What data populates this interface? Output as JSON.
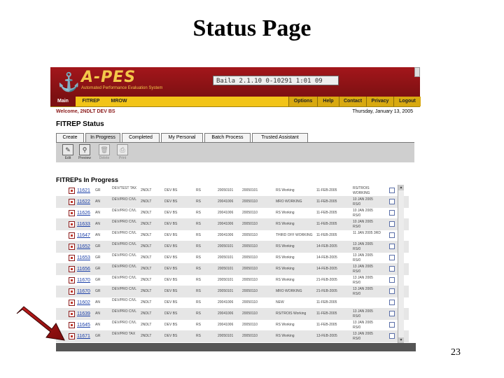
{
  "slide": {
    "title": "Status Page",
    "page_number": "23"
  },
  "app": {
    "logo_text": "A-PES",
    "logo_subtitle": "Automated Performance Evaluation System",
    "ticker": "Baila 2.1.10 0-10291 1:01 09"
  },
  "menu": {
    "left_tabs": [
      {
        "label": "Main"
      },
      {
        "label": "FITREP"
      },
      {
        "label": "MROW"
      }
    ],
    "right_tabs": [
      {
        "label": "Options"
      },
      {
        "label": "Help"
      },
      {
        "label": "Contact"
      },
      {
        "label": "Privacy"
      },
      {
        "label": "Logout"
      }
    ]
  },
  "welcome": "Welcome, 2NDLT DEV BS",
  "date": "Thursday, January 13, 2005",
  "section_title": "FITREP Status",
  "tabs": [
    {
      "label": "Create"
    },
    {
      "label": "In Progress"
    },
    {
      "label": "Completed"
    },
    {
      "label": "My Personal"
    },
    {
      "label": "Batch Process"
    },
    {
      "label": "Trusted Assistant"
    }
  ],
  "toolbar": [
    {
      "label": "Edit",
      "icon": "edit-icon"
    },
    {
      "label": "Preview",
      "icon": "preview-icon"
    },
    {
      "label": "Delete",
      "icon": "trash-icon"
    },
    {
      "label": "Print",
      "icon": "print-icon"
    }
  ],
  "list_title": "FITREPs In Progress",
  "rows": [
    {
      "id": "11621",
      "c2": "GR",
      "c3": "DEV/TEST TAX",
      "c4": "2NDLT",
      "c5": "DEV BS",
      "c6": "RS",
      "c7": "20050101",
      "c8": "20050101",
      "c9": "RS Working",
      "c10": "11-FEB-2005",
      "c11": "RS/TROIS WORKING"
    },
    {
      "id": "11622",
      "c2": "AN",
      "c3": "DEV/PRO CIVL",
      "c4": "2NDLT",
      "c5": "DEV BS",
      "c6": "RS",
      "c7": "20041006",
      "c8": "20050110",
      "c9": "MRO WORKING",
      "c10": "11-FEB-2005",
      "c11": "10 JAN 2005 RS/0"
    },
    {
      "id": "11626",
      "c2": "AN",
      "c3": "DEV/PRO CIVL",
      "c4": "2NDLT",
      "c5": "DEV BS",
      "c6": "RS",
      "c7": "20041006",
      "c8": "20050110",
      "c9": "RS Working",
      "c10": "11-FEB-2005",
      "c11": "10 JAN 2005 RS/0"
    },
    {
      "id": "11633",
      "c2": "AN",
      "c3": "DEV/PRO CIVL",
      "c4": "2NDLT",
      "c5": "DEV BS",
      "c6": "RS",
      "c7": "20041006",
      "c8": "20050110",
      "c9": "RS Working",
      "c10": "11-FEB-2005",
      "c11": "10 JAN 2005 RS/0"
    },
    {
      "id": "11647",
      "c2": "AN",
      "c3": "DEV/PRO CIVL",
      "c4": "2NDLT",
      "c5": "DEV BS",
      "c6": "RS",
      "c7": "20041006",
      "c8": "20050110",
      "c9": "THIRD OFF WORKING",
      "c10": "11-FEB-2005",
      "c11": "11 JAN 2005 3RD"
    },
    {
      "id": "11652",
      "c2": "GR",
      "c3": "DEV/PRO CIVL",
      "c4": "2NDLT",
      "c5": "DEV BS",
      "c6": "RS",
      "c7": "20050101",
      "c8": "20050110",
      "c9": "RS Working",
      "c10": "14-FEB-2005",
      "c11": "13 JAN 2005 RS/0"
    },
    {
      "id": "11653",
      "c2": "GR",
      "c3": "DEV/PRO CIVL",
      "c4": "2NDLT",
      "c5": "DEV BS",
      "c6": "RS",
      "c7": "20050101",
      "c8": "20050110",
      "c9": "RS Working",
      "c10": "14-FEB-2005",
      "c11": "13 JAN 2005 RS/0"
    },
    {
      "id": "11656",
      "c2": "GR",
      "c3": "DEV/PRO CIVL",
      "c4": "2NDLT",
      "c5": "DEV BS",
      "c6": "RS",
      "c7": "20050101",
      "c8": "20050110",
      "c9": "RS Working",
      "c10": "14-FEB-2005",
      "c11": "13 JAN 2005 RS/0"
    },
    {
      "id": "11670",
      "c2": "GR",
      "c3": "DEV/PRO CIVL",
      "c4": "2NDLT",
      "c5": "DEV BS",
      "c6": "RS",
      "c7": "20050101",
      "c8": "20050110",
      "c9": "RS Working",
      "c10": "21-FEB-2005",
      "c11": "13 JAN 2005 RS/0"
    },
    {
      "id": "11670",
      "c2": "GR",
      "c3": "DEV/PRO CIVL",
      "c4": "2NDLT",
      "c5": "DEV BS",
      "c6": "RS",
      "c7": "20050101",
      "c8": "20050110",
      "c9": "MRO WORKING",
      "c10": "21-FEB-2005",
      "c11": "13 JAN 2005 RS/0"
    },
    {
      "id": "11602",
      "c2": "AN",
      "c3": "DEV/PRO CIVL",
      "c4": "2NDLT",
      "c5": "DEV BS",
      "c6": "RS",
      "c7": "20041006",
      "c8": "20050110",
      "c9": "NEW",
      "c10": "11-FEB-2005",
      "c11": ""
    },
    {
      "id": "11639",
      "c2": "AN",
      "c3": "DEV/PRO CIVL",
      "c4": "2NDLT",
      "c5": "DEV BS",
      "c6": "RS",
      "c7": "20041006",
      "c8": "20050110",
      "c9": "RS/TROIS Working",
      "c10": "11-FEB-2005",
      "c11": "13 JAN 2005 RS/0"
    },
    {
      "id": "11645",
      "c2": "AN",
      "c3": "DEV/PRO CIVL",
      "c4": "2NDLT",
      "c5": "DEV BS",
      "c6": "RS",
      "c7": "20041006",
      "c8": "20050110",
      "c9": "RS Working",
      "c10": "11-FEB-2005",
      "c11": "13 JAN 2005 RS/0"
    },
    {
      "id": "11671",
      "c2": "GR",
      "c3": "DEV/PRO TAX",
      "c4": "2NDLT",
      "c5": "DEV BS",
      "c6": "RS",
      "c7": "20050101",
      "c8": "20050110",
      "c9": "RS Working",
      "c10": "13-FEB-2005",
      "c11": "13 JAN 2005 RS/0"
    }
  ],
  "colors": {
    "brand_red": "#7d1012",
    "menu_yellow": "#f2c418",
    "link_blue": "#1a3fa8",
    "arrow_red": "#a80f0f"
  }
}
